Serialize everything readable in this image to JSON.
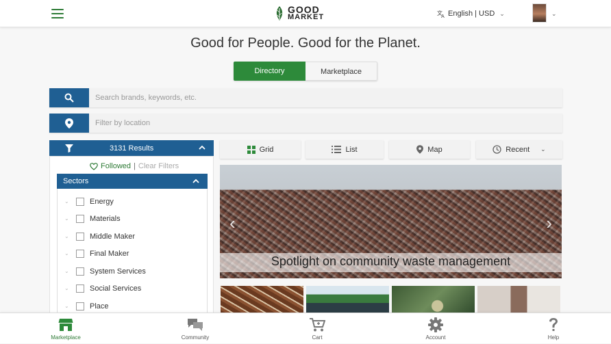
{
  "header": {
    "logo_line1": "GOOD",
    "logo_line2": "MARKET",
    "language_currency": "English | USD"
  },
  "hero": {
    "headline": "Good for People. Good for the Planet."
  },
  "mode_toggle": {
    "directory_label": "Directory",
    "marketplace_label": "Marketplace",
    "active": "Directory"
  },
  "search": {
    "placeholder": "Search brands, keywords, etc.",
    "location_placeholder": "Filter by location"
  },
  "filters": {
    "results_label": "3131 Results",
    "followed_label": "Followed",
    "separator": "|",
    "clear_label": "Clear Filters",
    "sectors_title": "Sectors",
    "sectors": [
      {
        "label": "Energy"
      },
      {
        "label": "Materials"
      },
      {
        "label": "Middle Maker"
      },
      {
        "label": "Final Maker"
      },
      {
        "label": "System Services"
      },
      {
        "label": "Social Services"
      },
      {
        "label": "Place"
      }
    ]
  },
  "views": {
    "grid_label": "Grid",
    "list_label": "List",
    "map_label": "Map",
    "sort_label": "Recent",
    "active": "Grid"
  },
  "spotlight": {
    "caption": "Spotlight on community waste management"
  },
  "bottom_nav": {
    "items": [
      {
        "label": "Marketplace",
        "icon": "store-icon"
      },
      {
        "label": "Community",
        "icon": "chat-bubbles-icon"
      },
      {
        "label": "Cart",
        "icon": "cart-icon"
      },
      {
        "label": "Account",
        "icon": "gear-icon"
      },
      {
        "label": "Help",
        "icon": "question-icon"
      }
    ],
    "active": "Marketplace"
  },
  "colors": {
    "brand_green": "#2d8a3a",
    "brand_blue": "#1f5f93"
  }
}
